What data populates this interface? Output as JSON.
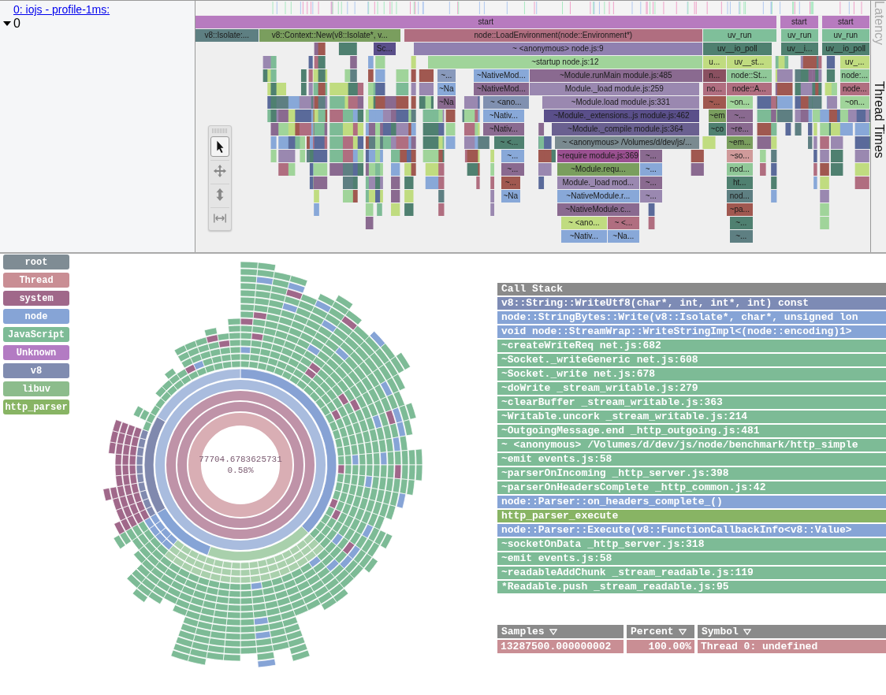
{
  "sidebar": {
    "link": "0: iojs - profile-1ms:",
    "tree": [
      {
        "label": "0",
        "expanded": true
      }
    ]
  },
  "side_tabs": [
    {
      "label": "Latency",
      "selected": false
    },
    {
      "label": "Thread Times",
      "selected": true
    }
  ],
  "tools": [
    {
      "kind": "pointer",
      "selected": true
    },
    {
      "kind": "pan",
      "selected": false
    },
    {
      "kind": "vertical-zoom",
      "selected": false
    },
    {
      "kind": "fit-width",
      "selected": false
    }
  ],
  "flame_rows": [
    {
      "blocks": [
        {
          "label": "start",
          "color": "#b77bbf"
        },
        {
          "label": "start",
          "color": "#b77bbf"
        },
        {
          "label": "start",
          "color": "#b77bbf"
        }
      ]
    },
    {
      "blocks": [
        {
          "label": "v8::Isolate:...",
          "color": "#5e7f82"
        },
        {
          "label": "v8::Context::New(v8::Isolate*, v...",
          "color": "#7a9e5e"
        },
        {
          "label": "node::LoadEnvironment(node::Environment*)",
          "color": "#b06e80"
        },
        {
          "label": "uv_run",
          "color": "#7fbf9a"
        },
        {
          "label": "uv_run",
          "color": "#7fbf9a"
        },
        {
          "label": "uv_run",
          "color": "#7fbf9a"
        }
      ]
    },
    {
      "blocks": [
        {
          "label": "Sc...",
          "color": "#5a4f8a"
        },
        {
          "label": "~ <anonymous> node.js:9",
          "color": "#9080b0"
        },
        {
          "label": "uv__io_poll",
          "color": "#4f8070"
        },
        {
          "label": "uv__i...",
          "color": "#4f8070"
        },
        {
          "label": "uv__io_poll",
          "color": "#4f8070"
        }
      ]
    },
    {
      "blocks": [
        {
          "label": "~startup node.js:12",
          "color": "#a0d49a"
        },
        {
          "label": "u...",
          "color": "#c0dc80"
        },
        {
          "label": "uv__st...",
          "color": "#c0dc80"
        },
        {
          "label": "uv_...",
          "color": "#c0dc80"
        }
      ]
    },
    {
      "blocks": [
        {
          "label": "~...",
          "color": "#8899bb"
        },
        {
          "label": "~NativeMod...",
          "color": "#88a8d8"
        },
        {
          "label": "~Module.runMain module.js:485",
          "color": "#8a6a90"
        },
        {
          "label": "n...",
          "color": "#8a5060"
        },
        {
          "label": "node::St...",
          "color": "#90c898"
        },
        {
          "label": "node:...",
          "color": "#90c898"
        }
      ]
    },
    {
      "blocks": [
        {
          "label": "~Na",
          "color": "#88a8d8"
        },
        {
          "label": "~NativeMod...",
          "color": "#8a6a90"
        },
        {
          "label": "Module._load module.js:259",
          "color": "#9a88b0"
        },
        {
          "label": "no...",
          "color": "#b06e80"
        },
        {
          "label": "node::A...",
          "color": "#b06e80"
        },
        {
          "label": "node...",
          "color": "#b06e80"
        }
      ]
    },
    {
      "blocks": [
        {
          "label": "~Na",
          "color": "#8a6a90"
        },
        {
          "label": "~ <ano...",
          "color": "#8090b0"
        },
        {
          "label": "~Module.load module.js:331",
          "color": "#9a88b0"
        },
        {
          "label": "~...",
          "color": "#a05850"
        },
        {
          "label": "~on...",
          "color": "#a0d49a"
        },
        {
          "label": "~on...",
          "color": "#a0d49a"
        }
      ]
    },
    {
      "blocks": [
        {
          "label": "~Nativ...",
          "color": "#88a8d8"
        },
        {
          "label": "~Module._extensions..js module.js:462",
          "color": "#5a4f8a"
        },
        {
          "label": "~em",
          "color": "#7a9e5e"
        },
        {
          "label": "~...",
          "color": "#8a6a90"
        }
      ]
    },
    {
      "blocks": [
        {
          "label": "~Nativ...",
          "color": "#8a6a90"
        },
        {
          "label": "~Module._compile module.js:364",
          "color": "#6a6090"
        },
        {
          "label": "~co",
          "color": "#4f8070"
        },
        {
          "label": "~re...",
          "color": "#8a6a90"
        }
      ]
    },
    {
      "blocks": [
        {
          "label": "~ <...",
          "color": "#4f8070"
        },
        {
          "label": "~ <anonymous> /Volumes/d/dev/js/...",
          "color": "#7a8a90"
        },
        {
          "label": "~em...",
          "color": "#7a9e5e"
        }
      ]
    },
    {
      "blocks": [
        {
          "label": "~...",
          "color": "#88a8d8"
        },
        {
          "label": "~require module.js:369",
          "color": "#9a5090"
        },
        {
          "label": "~...",
          "color": "#8a6a90"
        },
        {
          "label": "~so...",
          "color": "#d09a9a"
        }
      ]
    },
    {
      "blocks": [
        {
          "label": "~...",
          "color": "#8a6a90"
        },
        {
          "label": "~Module.requ...",
          "color": "#7a9e5e"
        },
        {
          "label": "~...",
          "color": "#88a8d8"
        },
        {
          "label": "nod...",
          "color": "#90c898"
        }
      ]
    },
    {
      "blocks": [
        {
          "label": "~...",
          "color": "#a05850"
        },
        {
          "label": "Module._load mod...",
          "color": "#9a88b0"
        },
        {
          "label": "~...",
          "color": "#8a6a90"
        },
        {
          "label": "ht...",
          "color": "#4f8070"
        }
      ]
    },
    {
      "blocks": [
        {
          "label": "~Na",
          "color": "#88a8d8"
        },
        {
          "label": "~NativeModule.r...",
          "color": "#88a8d8"
        },
        {
          "label": "~...",
          "color": "#9a88b0"
        },
        {
          "label": "nod...",
          "color": "#5e7f82"
        }
      ]
    },
    {
      "blocks": [
        {
          "label": "~NativeModule.c...",
          "color": "#8a6a90"
        },
        {
          "label": "~pa...",
          "color": "#a05850"
        }
      ]
    },
    {
      "blocks": [
        {
          "label": "~ <ano...",
          "color": "#c0dc80"
        },
        {
          "label": "~ <...",
          "color": "#b06e80"
        },
        {
          "label": "~...",
          "color": "#4f8070"
        }
      ]
    },
    {
      "blocks": [
        {
          "label": "~Nativ...",
          "color": "#88a8d8"
        },
        {
          "label": "~Na...",
          "color": "#88a8d8"
        },
        {
          "label": "~...",
          "color": "#5e7f82"
        }
      ]
    }
  ],
  "legend": [
    {
      "label": "root",
      "color": "#7f8c94"
    },
    {
      "label": "Thread",
      "color": "#c98e94"
    },
    {
      "label": "system",
      "color": "#a0688a"
    },
    {
      "label": "node",
      "color": "#86a4d6"
    },
    {
      "label": "JavaScript",
      "color": "#7dbb96"
    },
    {
      "label": "Unknown",
      "color": "#b37bc3"
    },
    {
      "label": "v8",
      "color": "#808cb0"
    },
    {
      "label": "libuv",
      "color": "#8cbc8c"
    },
    {
      "label": "http_parser",
      "color": "#88b464"
    }
  ],
  "sunburst": {
    "value": "77704.6783625731",
    "percent": "0.58%"
  },
  "call_stack": {
    "title": "Call Stack",
    "frames": [
      {
        "label": "v8::String::WriteUtf8(char*, int, int*, int) const",
        "color": "#7d8bb5"
      },
      {
        "label": "node::StringBytes::Write(v8::Isolate*, char*, unsigned lon",
        "color": "#86a4d6"
      },
      {
        "label": "void node::StreamWrap::WriteStringImpl<(node::encoding)1>",
        "color": "#86a4d6"
      },
      {
        "label": "~createWriteReq net.js:682",
        "color": "#7dbb96"
      },
      {
        "label": "~Socket._writeGeneric net.js:608",
        "color": "#7dbb96"
      },
      {
        "label": "~Socket._write net.js:678",
        "color": "#7dbb96"
      },
      {
        "label": "~doWrite _stream_writable.js:279",
        "color": "#7dbb96"
      },
      {
        "label": "~clearBuffer _stream_writable.js:363",
        "color": "#7dbb96"
      },
      {
        "label": "~Writable.uncork _stream_writable.js:214",
        "color": "#7dbb96"
      },
      {
        "label": "~OutgoingMessage.end _http_outgoing.js:481",
        "color": "#7dbb96"
      },
      {
        "label": "~ <anonymous> /Volumes/d/dev/js/node/benchmark/http_simple",
        "color": "#7dbb96"
      },
      {
        "label": "~emit events.js:58",
        "color": "#7dbb96"
      },
      {
        "label": "~parserOnIncoming _http_server.js:398",
        "color": "#7dbb96"
      },
      {
        "label": "~parserOnHeadersComplete _http_common.js:42",
        "color": "#7dbb96"
      },
      {
        "label": "node::Parser::on_headers_complete_()",
        "color": "#86a4d6"
      },
      {
        "label": "http_parser_execute",
        "color": "#88b464"
      },
      {
        "label": "node::Parser::Execute(v8::FunctionCallbackInfo<v8::Value>",
        "color": "#86a4d6"
      },
      {
        "label": "~socketOnData _http_server.js:318",
        "color": "#7dbb96"
      },
      {
        "label": "~emit events.js:58",
        "color": "#7dbb96"
      },
      {
        "label": "~readableAddChunk _stream_readable.js:119",
        "color": "#7dbb96"
      },
      {
        "label": "*Readable.push _stream_readable.js:95",
        "color": "#7dbb96"
      }
    ]
  },
  "table": {
    "columns": [
      {
        "label": "Samples"
      },
      {
        "label": "Percent"
      },
      {
        "label": "Symbol"
      }
    ],
    "rows": [
      {
        "color": "#c98e94",
        "cells": [
          "13287500.000000002",
          "100.00%",
          "Thread 0: undefined"
        ]
      }
    ]
  }
}
